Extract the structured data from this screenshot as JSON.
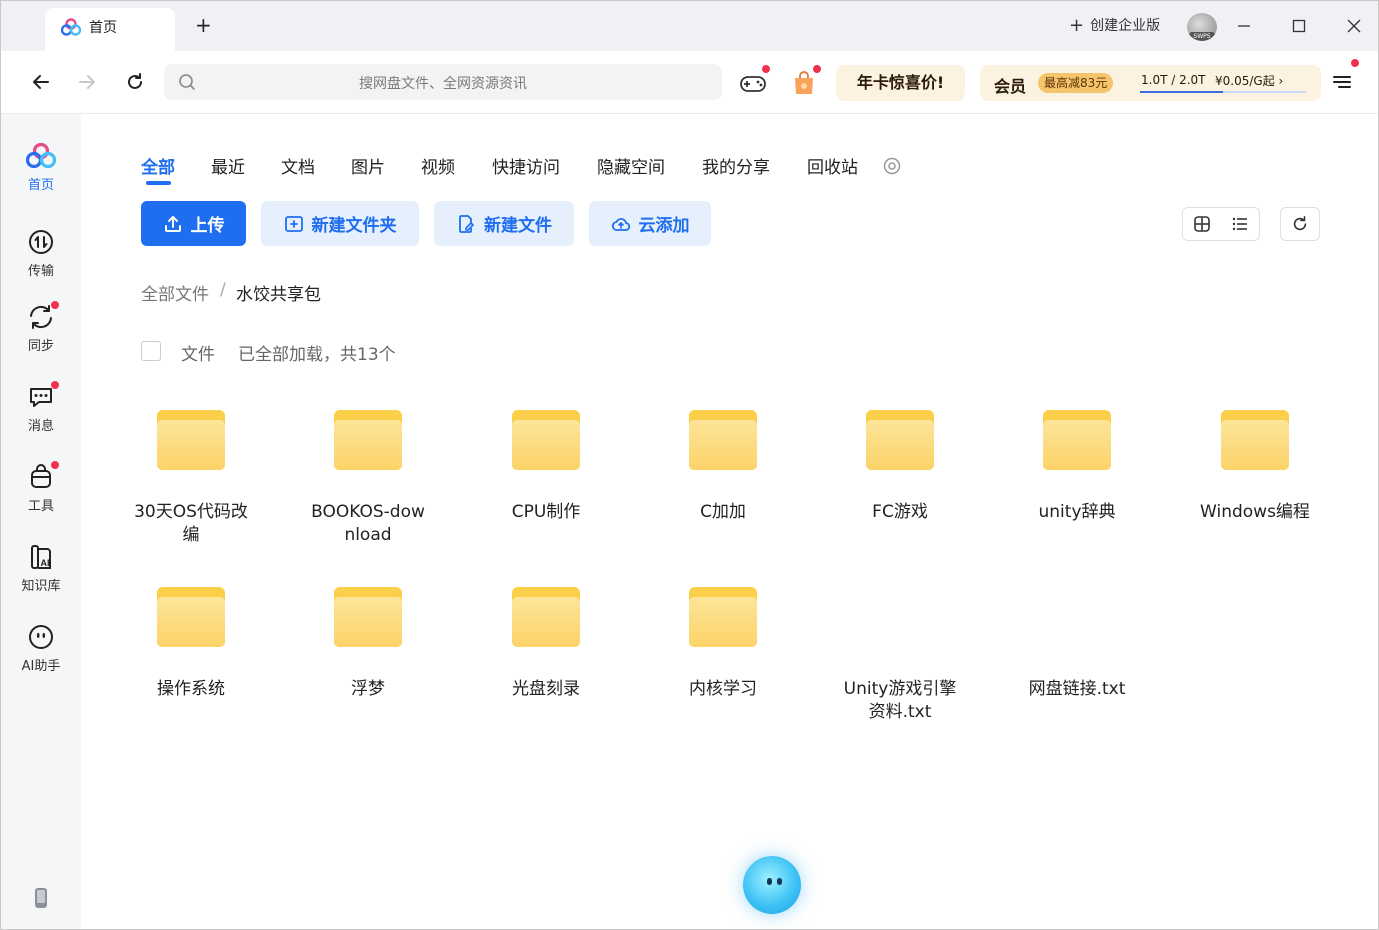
{
  "titlebar": {
    "tab_label": "首页",
    "new_tab": "+",
    "enterprise_label": "创建企业版",
    "avatar_tag": "SWPS"
  },
  "navbar": {
    "search_placeholder": "搜网盘文件、全网资源资讯",
    "promo_label": "年卡惊喜价!",
    "vip_label": "会员",
    "vip_badge": "最高减83元",
    "vip_storage": "1.0T / 2.0T",
    "vip_price": "¥0.05/G起 ›",
    "storage_used_fraction": 0.5
  },
  "sidebar": {
    "items": [
      {
        "label": "首页",
        "icon": "home-cloud-icon"
      },
      {
        "label": "传输",
        "icon": "transfer-icon"
      },
      {
        "label": "同步",
        "icon": "sync-icon"
      },
      {
        "label": "消息",
        "icon": "message-icon"
      },
      {
        "label": "工具",
        "icon": "toolbox-icon"
      },
      {
        "label": "知识库",
        "icon": "knowledge-base-icon"
      },
      {
        "label": "AI助手",
        "icon": "ai-assistant-icon"
      }
    ]
  },
  "categories": [
    "全部",
    "最近",
    "文档",
    "图片",
    "视频",
    "快捷访问",
    "隐藏空间",
    "我的分享",
    "回收站"
  ],
  "actions": {
    "upload": "上传",
    "new_folder": "新建文件夹",
    "new_file": "新建文件",
    "cloud_add": "云添加"
  },
  "breadcrumb": {
    "root": "全部文件",
    "separator": "/",
    "current": "水饺共享包"
  },
  "listing": {
    "header_label": "文件",
    "status": "已全部加载，共13个"
  },
  "files": [
    {
      "name": "30天OS代码改编",
      "type": "folder"
    },
    {
      "name": "BOOKOS-download",
      "type": "folder"
    },
    {
      "name": "CPU制作",
      "type": "folder"
    },
    {
      "name": "C加加",
      "type": "folder"
    },
    {
      "name": "FC游戏",
      "type": "folder"
    },
    {
      "name": "unity辞典",
      "type": "folder"
    },
    {
      "name": "Windows编程",
      "type": "folder"
    },
    {
      "name": "操作系统",
      "type": "folder"
    },
    {
      "name": "浮梦",
      "type": "folder"
    },
    {
      "name": "光盘刻录",
      "type": "folder"
    },
    {
      "name": "内核学习",
      "type": "folder"
    },
    {
      "name": "Unity游戏引擎资料.txt",
      "type": "file"
    },
    {
      "name": "网盘链接.txt",
      "type": "file"
    }
  ],
  "colors": {
    "accent": "#1f6ef0",
    "folder": "#fccf4a",
    "notification_dot": "#f0314e",
    "promo_bg": "#fbf2e1"
  }
}
